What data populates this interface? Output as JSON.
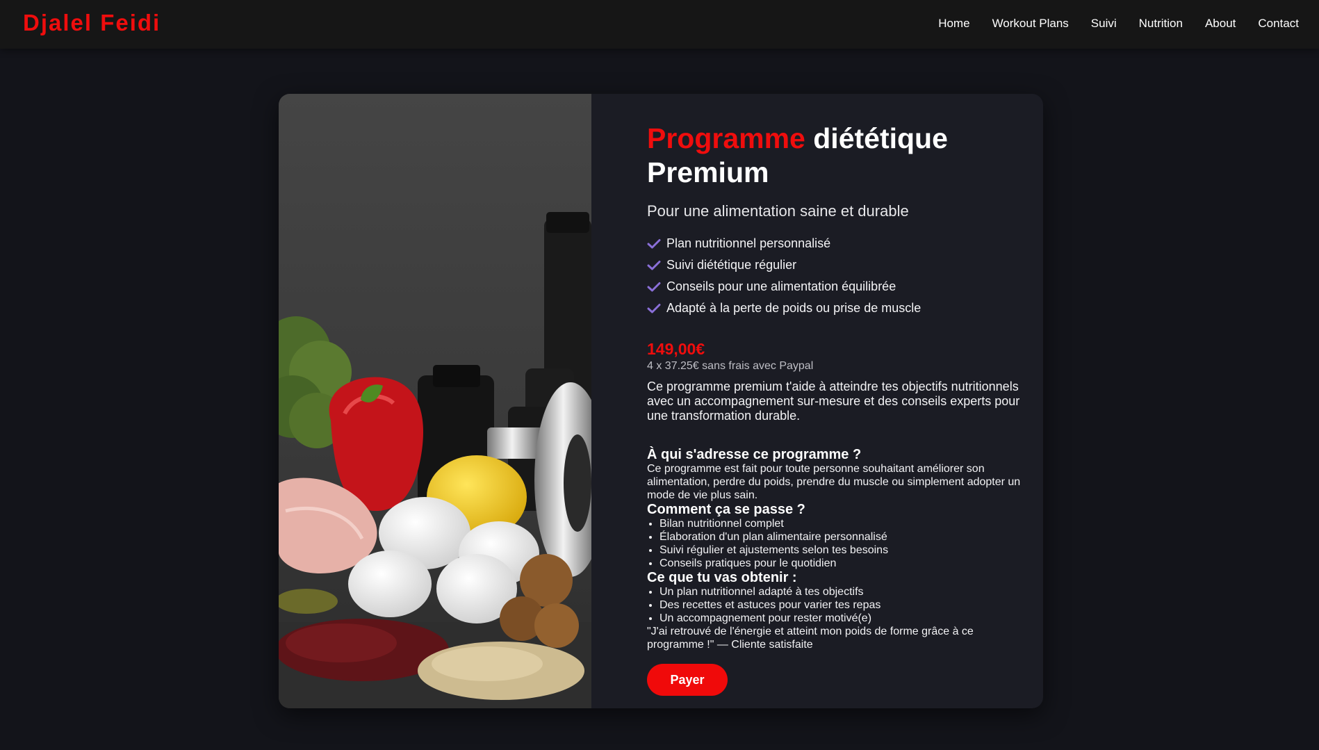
{
  "header": {
    "brand": "Djalel Feidi",
    "nav": [
      "Home",
      "Workout Plans",
      "Suivi",
      "Nutrition",
      "About",
      "Contact"
    ]
  },
  "program": {
    "title_accent": "Programme",
    "title_rest": " diététique Premium",
    "subtitle": "Pour une alimentation saine et durable",
    "features": [
      "Plan nutritionnel personnalisé",
      "Suivi diététique régulier",
      "Conseils pour une alimentation équilibrée",
      "Adapté à la perte de poids ou prise de muscle"
    ],
    "price": "149,00€",
    "installments": "4 x 37.25€ sans frais avec Paypal",
    "description": "Ce programme premium t'aide à atteindre tes objectifs nutritionnels avec un accompagnement sur-mesure et des conseils experts pour une transformation durable.",
    "who_title": "À qui s'adresse ce programme ?",
    "who_text": "Ce programme est fait pour toute personne souhaitant améliorer son alimentation, perdre du poids, prendre du muscle ou simplement adopter un mode de vie plus sain.",
    "how_title": "Comment ça se passe ?",
    "how_items": [
      "Bilan nutritionnel complet",
      "Élaboration d'un plan alimentaire personnalisé",
      "Suivi régulier et ajustements selon tes besoins",
      "Conseils pratiques pour le quotidien"
    ],
    "get_title": "Ce que tu vas obtenir :",
    "get_items": [
      "Un plan nutritionnel adapté à tes objectifs",
      "Des recettes et astuces pour varier tes repas",
      "Un accompagnement pour rester motivé(e)"
    ],
    "testimonial": "\"J'ai retrouvé de l'énergie et atteint mon poids de forme grâce à ce programme !\" — Cliente satisfaite",
    "pay_label": "Payer"
  },
  "colors": {
    "accent": "#ef0d0d",
    "check": "#8a6fd8",
    "background": "#13141a",
    "card": "#1b1c24"
  },
  "icons": {
    "feature": "check-icon"
  }
}
